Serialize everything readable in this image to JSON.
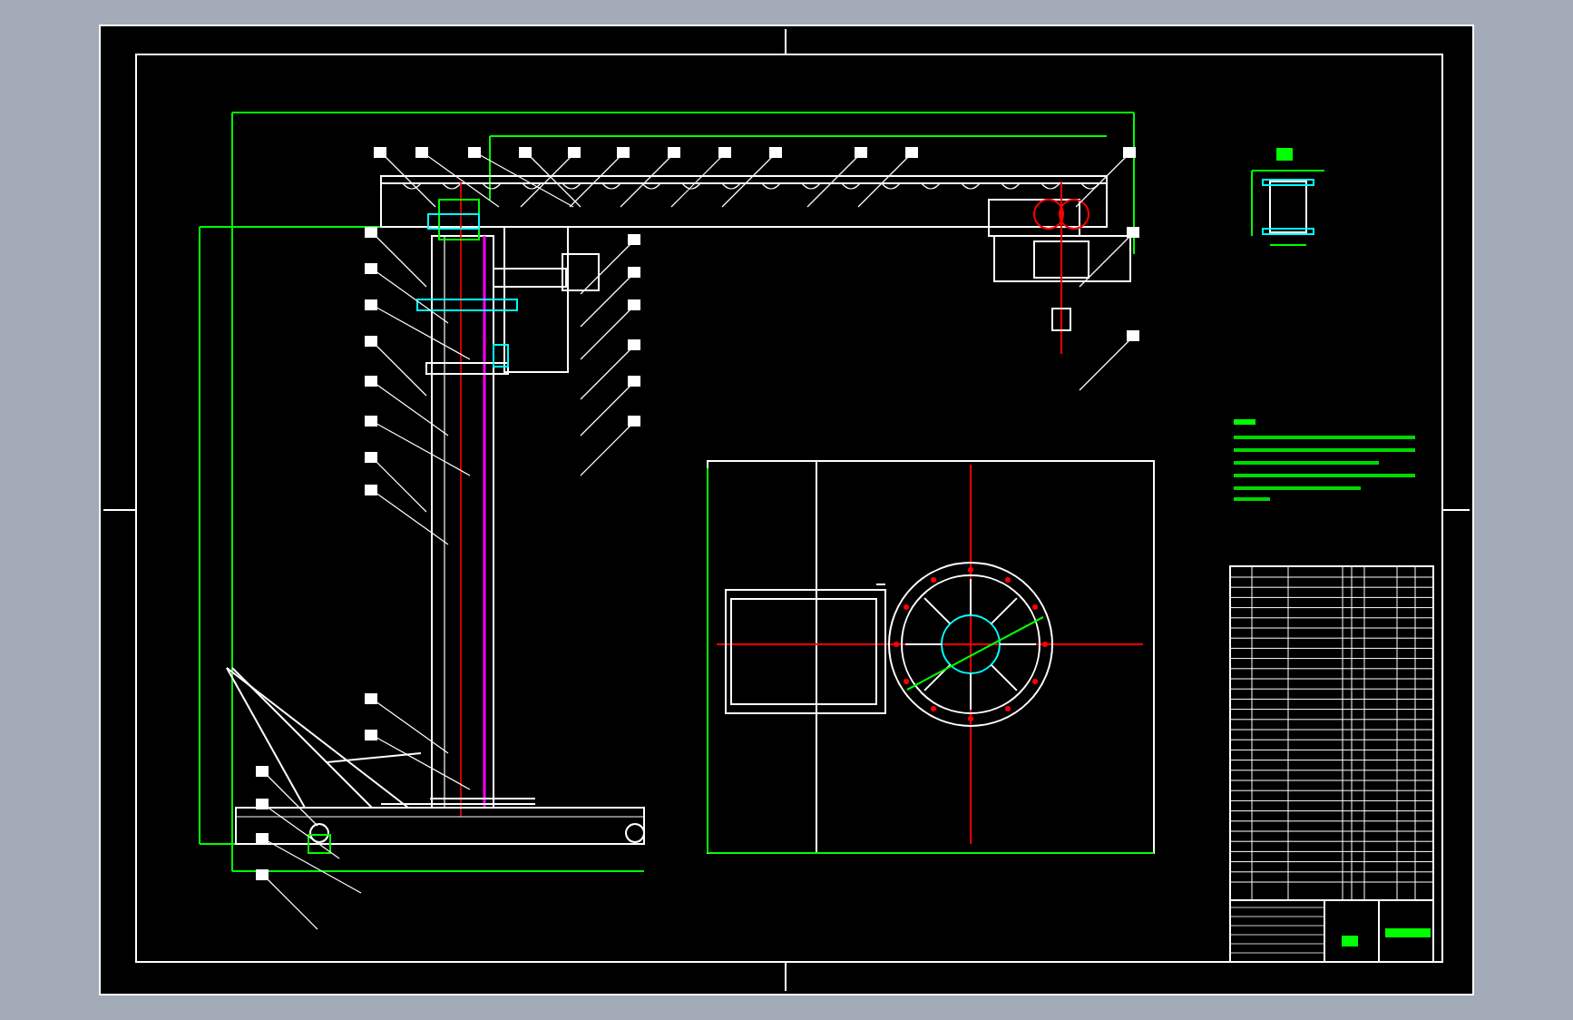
{
  "views": [
    {
      "kind": "elevation"
    },
    {
      "kind": "plan"
    },
    {
      "kind": "section"
    },
    {
      "kind": "notes"
    },
    {
      "kind": "parts-table"
    }
  ]
}
